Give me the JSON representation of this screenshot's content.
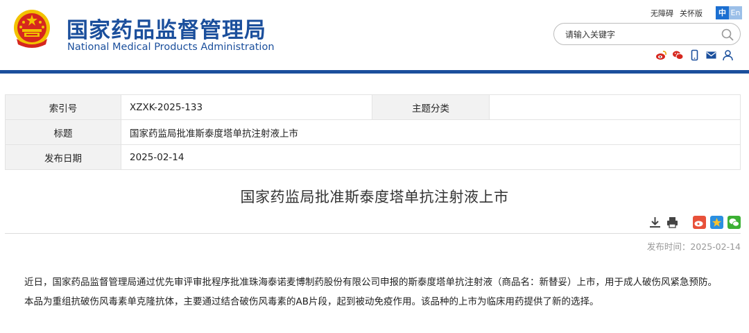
{
  "header": {
    "title_cn": "国家药品监督管理局",
    "title_en": "National Medical Products Administration",
    "toplinks": [
      "无障碍",
      "关怀版"
    ],
    "lang": {
      "zh": "中",
      "en": "En"
    },
    "search_placeholder": "请输入关键字",
    "icons": [
      "weibo-icon",
      "wechat-icon",
      "mobile-icon",
      "mail-icon",
      "user-icon"
    ]
  },
  "meta": {
    "index_label": "索引号",
    "index_value": "XZXK-2025-133",
    "category_label": "主题分类",
    "category_value": "",
    "title_label": "标题",
    "title_value": "国家药监局批准斯泰度塔单抗注射液上市",
    "date_label": "发布日期",
    "date_value": "2025-02-14"
  },
  "article": {
    "title": "国家药监局批准斯泰度塔单抗注射液上市",
    "pubdate": "发布时间：2025-02-14",
    "paragraphs": [
      "近日，国家药品监督管理局通过优先审评审批程序批准珠海泰诺麦博制药股份有限公司申报的斯泰度塔单抗注射液（商品名：新替妥）上市，用于成人破伤风紧急预防。",
      "本品为重组抗破伤风毒素单克隆抗体，主要通过结合破伤风毒素的AB片段，起到被动免疫作用。该品种的上市为临床用药提供了新的选择。"
    ]
  },
  "colors": {
    "brand_blue": "#1b4f9c",
    "emblem_red": "#d6271e",
    "emblem_gold": "#f2c200"
  }
}
